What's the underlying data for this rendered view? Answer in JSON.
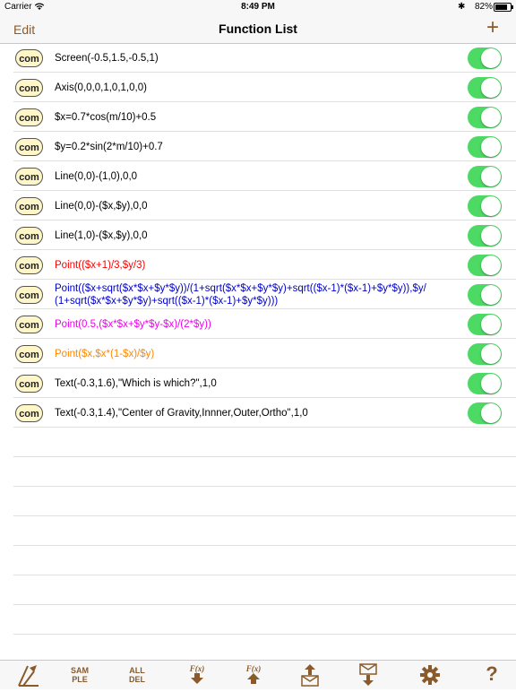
{
  "status": {
    "carrier": "Carrier",
    "time": "8:49 PM",
    "battery_pct": "82%",
    "battery_level": 0.82
  },
  "nav": {
    "edit": "Edit",
    "title": "Function List",
    "add": "+"
  },
  "rows": [
    {
      "badge": "com",
      "text": "Screen(-0.5,1.5,-0.5,1)",
      "color": "#000000",
      "on": true
    },
    {
      "badge": "com",
      "text": "Axis(0,0,0,1,0,1,0,0)",
      "color": "#000000",
      "on": true
    },
    {
      "badge": "com",
      "text": "$x=0.7*cos(m/10)+0.5",
      "color": "#000000",
      "on": true
    },
    {
      "badge": "com",
      "text": "$y=0.2*sin(2*m/10)+0.7",
      "color": "#000000",
      "on": true
    },
    {
      "badge": "com",
      "text": "Line(0,0)-(1,0),0,0",
      "color": "#000000",
      "on": true
    },
    {
      "badge": "com",
      "text": "Line(0,0)-($x,$y),0,0",
      "color": "#000000",
      "on": true
    },
    {
      "badge": "com",
      "text": "Line(1,0)-($x,$y),0,0",
      "color": "#000000",
      "on": true
    },
    {
      "badge": "com",
      "text": "Point(($x+1)/3,$y/3)",
      "color": "#ff0000",
      "on": true
    },
    {
      "badge": "com",
      "text": "Point(($x+sqrt($x*$x+$y*$y))/(1+sqrt($x*$x+$y*$y)+sqrt(($x-1)*($x-1)+$y*$y)),$y/",
      "text2": "(1+sqrt($x*$x+$y*$y)+sqrt(($x-1)*($x-1)+$y*$y)))",
      "color": "#0000cc",
      "on": true
    },
    {
      "badge": "com",
      "text": "Point(0.5,($x*$x+$y*$y-$x)/(2*$y))",
      "color": "#ee00ee",
      "on": true
    },
    {
      "badge": "com",
      "text": "Point($x,$x*(1-$x)/$y)",
      "color": "#ff8800",
      "on": true
    },
    {
      "badge": "com",
      "text": "Text(-0.3,1.6),\"Which is which?\",1,0",
      "color": "#000000",
      "on": true
    },
    {
      "badge": "com",
      "text": "Text(-0.3,1.4),\"Center of Gravity,Innner,Outer,Ortho\",1,0",
      "color": "#000000",
      "on": true
    }
  ],
  "tabs": [
    {
      "name": "graph",
      "label": ""
    },
    {
      "name": "sample",
      "label1": "SAM",
      "label2": "PLE"
    },
    {
      "name": "alldel",
      "label1": "ALL",
      "label2": "DEL"
    },
    {
      "name": "fx-down",
      "label": "F(x)"
    },
    {
      "name": "fx-up",
      "label": "F(x)"
    },
    {
      "name": "mail-out",
      "label": ""
    },
    {
      "name": "mail-in",
      "label": ""
    },
    {
      "name": "settings",
      "label": ""
    },
    {
      "name": "help",
      "label": "?"
    }
  ],
  "colors": {
    "accent": "#8a5a2b",
    "toggle_on": "#4cd964",
    "badge_fill": "#fff6c8"
  }
}
